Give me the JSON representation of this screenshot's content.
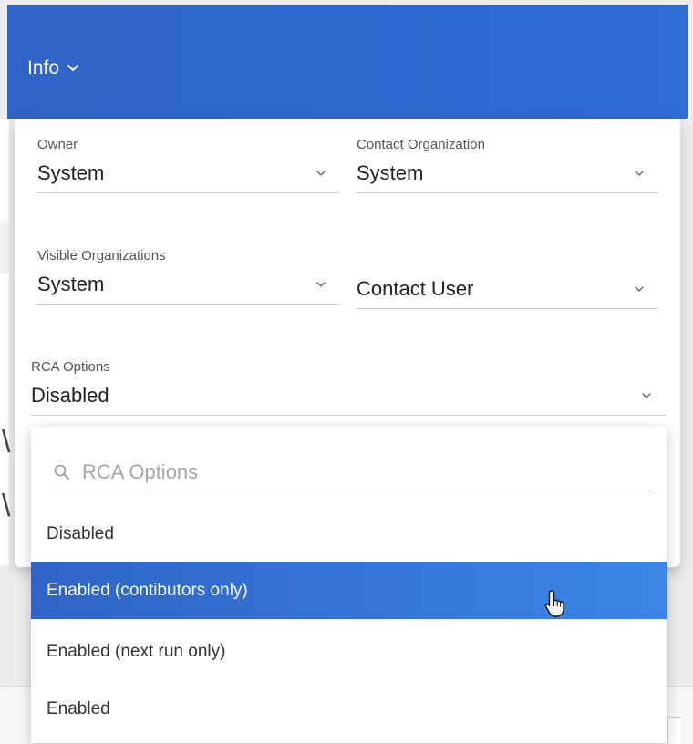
{
  "header": {
    "title": "Info",
    "chevron_icon": "chevron-down-icon",
    "color": "#2f63c7"
  },
  "fields": {
    "owner": {
      "label": "Owner",
      "value": "System"
    },
    "contact_org": {
      "label": "Contact Organization",
      "value": "System"
    },
    "visible_orgs": {
      "label": "Visible Organizations",
      "value": "System"
    },
    "contact_user": {
      "value": "Contact User"
    },
    "rca_options": {
      "label": "RCA Options",
      "value": "Disabled"
    }
  },
  "dropdown": {
    "search_placeholder": "RCA Options",
    "search_icon": "search-icon",
    "options": [
      {
        "label": "Disabled",
        "highlighted": false
      },
      {
        "label": "Enabled (contibutors only)",
        "highlighted": true
      },
      {
        "label": "Enabled (next run only)",
        "highlighted": false
      },
      {
        "label": "Enabled",
        "highlighted": false
      }
    ],
    "highlight_color": "#2f63c7"
  },
  "cursor_icon": "hand-pointer-icon"
}
